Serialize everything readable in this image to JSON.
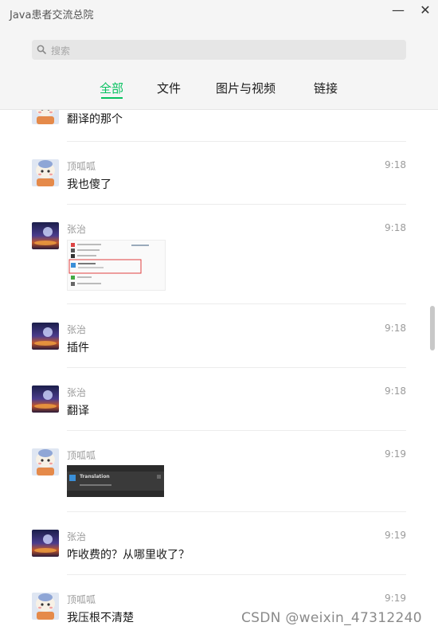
{
  "window": {
    "title": "Java患者交流总院",
    "minimize_label": "—",
    "close_label": "✕"
  },
  "search": {
    "placeholder": "搜索",
    "icon": "search-icon"
  },
  "tabs": [
    {
      "label": "全部",
      "active": true
    },
    {
      "label": "文件",
      "active": false
    },
    {
      "label": "图片与视频",
      "active": false
    },
    {
      "label": "链接",
      "active": false
    }
  ],
  "messages": [
    {
      "sender": "",
      "time": "",
      "text": "翻译的那个",
      "avatar": "cartoon-avatar"
    },
    {
      "sender": "顶呱呱",
      "time": "9:18",
      "text": "我也傻了",
      "avatar": "cartoon-avatar"
    },
    {
      "sender": "张治",
      "time": "9:18",
      "text": "",
      "avatar": "night-sky-avatar",
      "attachment": "screenshot-image"
    },
    {
      "sender": "张治",
      "time": "9:18",
      "text": "插件",
      "avatar": "night-sky-avatar"
    },
    {
      "sender": "张治",
      "time": "9:18",
      "text": "翻译",
      "avatar": "night-sky-avatar"
    },
    {
      "sender": "顶呱呱",
      "time": "9:19",
      "text": "",
      "avatar": "cartoon-avatar",
      "attachment": "screenshot-image",
      "attachment_text": "Translation"
    },
    {
      "sender": "张治",
      "time": "9:19",
      "text": "咋收费的？从哪里收了？",
      "avatar": "night-sky-avatar"
    },
    {
      "sender": "顶呱呱",
      "time": "9:19",
      "text": "我压根不清楚",
      "avatar": "cartoon-avatar"
    }
  ],
  "watermark": "CSDN @weixin_47312240",
  "colors": {
    "accent": "#07c160",
    "header_bg": "#f5f5f5",
    "search_bg": "#e6e6e6",
    "muted_text": "#9b9b9b"
  }
}
